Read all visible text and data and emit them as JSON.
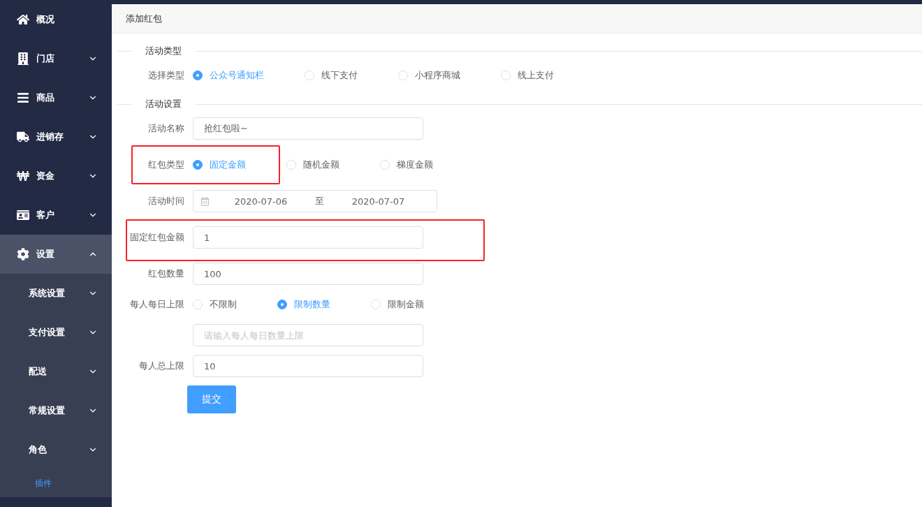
{
  "sidebar": {
    "items": [
      {
        "label": "概况"
      },
      {
        "label": "门店",
        "expanded": false
      },
      {
        "label": "商品",
        "expanded": false
      },
      {
        "label": "进销存",
        "expanded": false
      },
      {
        "label": "资金",
        "expanded": false
      },
      {
        "label": "客户",
        "expanded": false
      },
      {
        "label": "设置",
        "expanded": true,
        "children": [
          {
            "label": "系统设置",
            "expanded": false,
            "selected": false
          },
          {
            "label": "支付设置",
            "expanded": false,
            "selected": false
          },
          {
            "label": "配送",
            "expanded": false,
            "selected": false
          },
          {
            "label": "常规设置",
            "expanded": false,
            "selected": false
          },
          {
            "label": "角色",
            "expanded": false,
            "selected": false
          },
          {
            "label": "插件",
            "selected": true
          }
        ]
      }
    ]
  },
  "page": {
    "title": "添加红包"
  },
  "form": {
    "rows": [
      {
        "kind": "section",
        "label": "活动类型"
      },
      {
        "kind": "radio",
        "label": "选择类型",
        "highlighted": false,
        "options": [
          {
            "label": "公众号通知栏",
            "selected": true
          },
          {
            "label": "线下支付",
            "selected": false
          },
          {
            "label": "小程序商城",
            "selected": false
          },
          {
            "label": "线上支付",
            "selected": false
          }
        ]
      },
      {
        "kind": "section",
        "label": "活动设置"
      },
      {
        "kind": "input",
        "label": "活动名称",
        "highlighted": false,
        "value": "抢红包啦~"
      },
      {
        "kind": "radio",
        "label": "红包类型",
        "highlighted": true,
        "options": [
          {
            "label": "固定金额",
            "selected": true
          },
          {
            "label": "随机金额",
            "selected": false
          },
          {
            "label": "梯度金额",
            "selected": false
          }
        ]
      },
      {
        "kind": "date",
        "label": "活动时间",
        "highlighted": false,
        "start": "2020-07-06",
        "separator": "至",
        "end": "2020-07-07"
      },
      {
        "kind": "input",
        "label": "固定红包金额",
        "highlighted": true,
        "value": "1"
      },
      {
        "kind": "input",
        "label": "红包数量",
        "highlighted": false,
        "value": "100"
      },
      {
        "kind": "radio",
        "label": "每人每日上限",
        "highlighted": false,
        "options": [
          {
            "label": "不限制",
            "selected": false
          },
          {
            "label": "限制数量",
            "selected": true
          },
          {
            "label": "限制金额",
            "selected": false
          }
        ]
      },
      {
        "kind": "input",
        "highlighted": false,
        "placeholder": "请输入每人每日数量上限"
      },
      {
        "kind": "input",
        "label": "每人总上限",
        "highlighted": false,
        "value": "10"
      },
      {
        "kind": "button",
        "label": "提交"
      }
    ]
  }
}
